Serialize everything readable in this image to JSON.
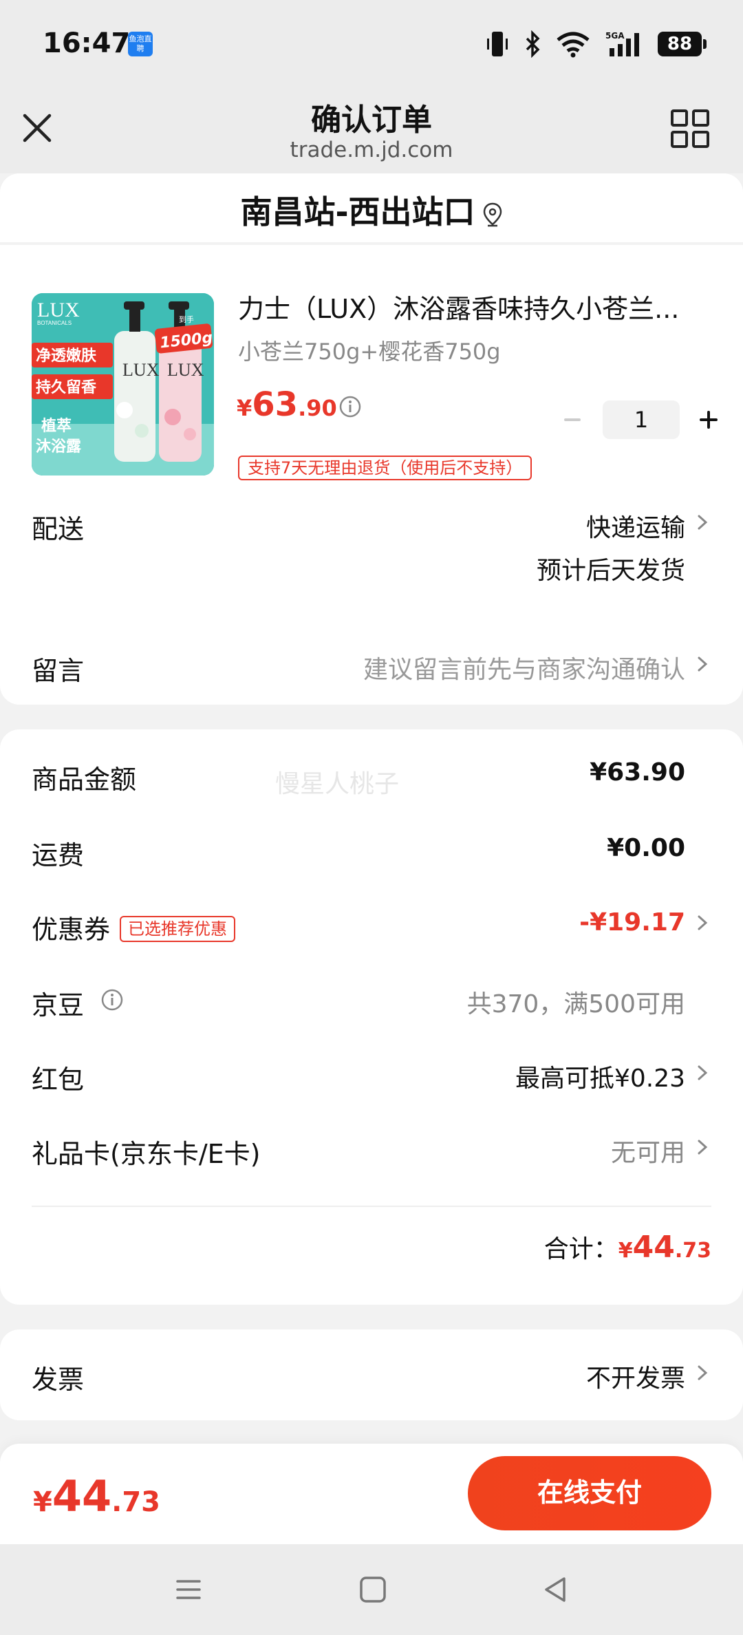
{
  "status": {
    "time": "16:47",
    "app_badge": "鱼泡直聘",
    "battery": "88"
  },
  "header": {
    "title": "确认订单",
    "url": "trade.m.jd.com"
  },
  "address": {
    "text": "南昌站-西出站口"
  },
  "product": {
    "title": "力士（LUX）沐浴露香味持久小苍兰...",
    "spec": "小苍兰750g+樱花香750g",
    "price_yen": "¥",
    "price_int": "63",
    "price_dec": ".90",
    "quantity": "1",
    "return_policy": "支持7天无理由退货（使用后不支持）",
    "image": {
      "brand": "LUX",
      "brand_sub": "BOTANICALS",
      "tag1": "净透嫩肤",
      "tag2": "持久留香",
      "tag3": "植萃\n沐浴露",
      "weight_tag": "1500g",
      "weight_tag_small": "到手"
    }
  },
  "delivery": {
    "label": "配送",
    "method": "快递运输",
    "eta": "预计后天发货"
  },
  "message": {
    "label": "留言",
    "placeholder": "建议留言前先与商家沟通确认"
  },
  "summary": {
    "watermark": "慢星人桃子",
    "goods_label": "商品金额",
    "goods_value": "¥63.90",
    "shipping_label": "运费",
    "shipping_value": "¥0.00",
    "coupon_label": "优惠券",
    "coupon_tag": "已选推荐优惠",
    "coupon_value": "-¥19.17",
    "beans_label": "京豆",
    "beans_value": "共370，满500可用",
    "redpacket_label": "红包",
    "redpacket_value": "最高可抵¥0.23",
    "giftcard_label": "礼品卡(京东卡/E卡)",
    "giftcard_value": "无可用",
    "total_label": "合计：",
    "total_yen": "¥",
    "total_int": "44",
    "total_dec": ".73"
  },
  "invoice": {
    "label": "发票",
    "value": "不开发票"
  },
  "pay_bar": {
    "yen": "¥",
    "amount_int": "44",
    "amount_dec": ".73",
    "button": "在线支付"
  },
  "colors": {
    "accent": "#e8372a",
    "pay_button": "#f0421d"
  }
}
